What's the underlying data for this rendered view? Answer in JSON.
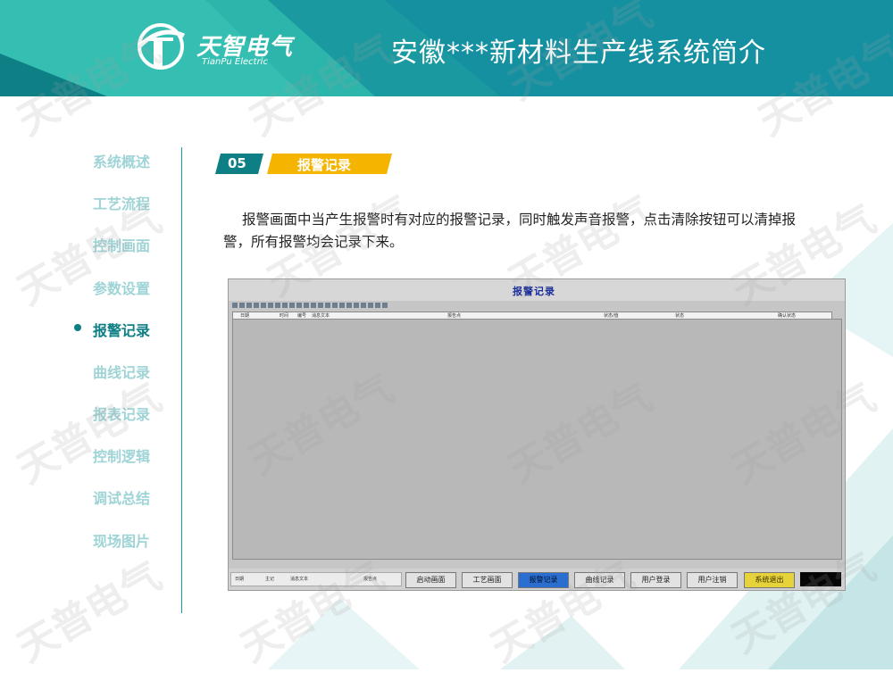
{
  "header": {
    "logo_text_cn": "天智电气",
    "logo_text_en": "TianPu Electric",
    "title": "安徽***新材料生产线系统简介"
  },
  "sidebar": {
    "items": [
      {
        "label": "系统概述",
        "active": false
      },
      {
        "label": "工艺流程",
        "active": false
      },
      {
        "label": "控制画面",
        "active": false
      },
      {
        "label": "参数设置",
        "active": false
      },
      {
        "label": "报警记录",
        "active": true
      },
      {
        "label": "曲线记录",
        "active": false
      },
      {
        "label": "报表记录",
        "active": false
      },
      {
        "label": "控制逻辑",
        "active": false
      },
      {
        "label": "调试总结",
        "active": false
      },
      {
        "label": "现场图片",
        "active": false
      }
    ]
  },
  "section": {
    "number": "05",
    "title": "报警记录"
  },
  "description": "报警画面中当产生报警时有对应的报警记录，同时触发声音报警，点击清除按钮可以清掉报警，所有报警均会记录下来。",
  "screenshot": {
    "title": "报警记录",
    "table_headers": [
      "日期",
      "时间",
      "编号",
      "消息文本",
      "报告点",
      "状态/值",
      "状态",
      "确认状态"
    ],
    "status_labels": [
      "日期",
      "主记",
      "消息文本",
      "报告点"
    ],
    "nav_buttons": [
      {
        "label": "启动画面",
        "state": "normal"
      },
      {
        "label": "工艺画面",
        "state": "normal"
      },
      {
        "label": "报警记录",
        "state": "active"
      },
      {
        "label": "曲线记录",
        "state": "normal"
      },
      {
        "label": "用户登录",
        "state": "normal"
      },
      {
        "label": "用户注销",
        "state": "normal"
      },
      {
        "label": "系统退出",
        "state": "clear"
      }
    ]
  },
  "watermark": "天普电气",
  "colors": {
    "teal": "#1a9aa0",
    "dark_teal": "#0e7f85",
    "yellow": "#f5b400",
    "sidebar_inactive": "#9fd4d6"
  }
}
